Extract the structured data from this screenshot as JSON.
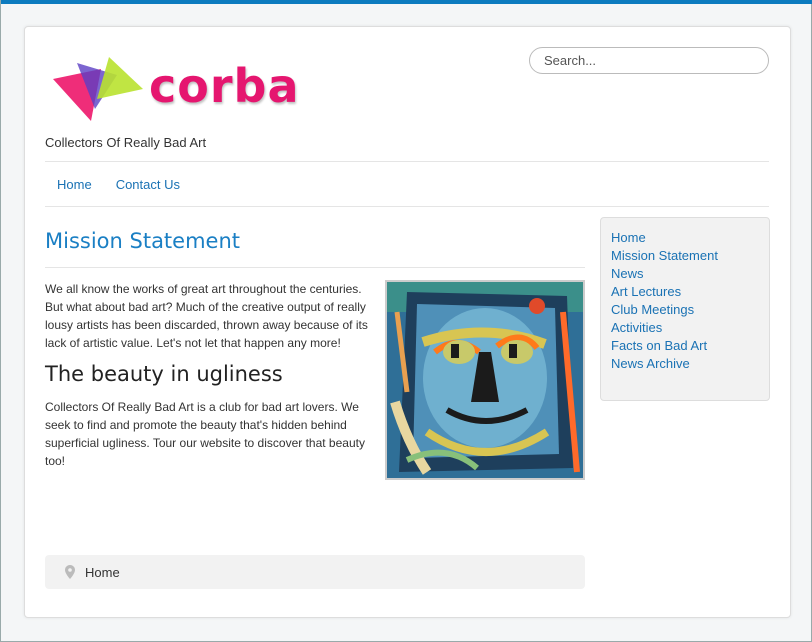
{
  "site": {
    "logo_text": "corba",
    "tagline": "Collectors Of Really Bad Art"
  },
  "search": {
    "placeholder": "Search..."
  },
  "nav": {
    "items": [
      {
        "label": "Home"
      },
      {
        "label": "Contact Us"
      }
    ]
  },
  "article": {
    "title": "Mission Statement",
    "intro": "We all know the works of great art throughout the centuries. But what about bad art? Much of the creative output of really lousy artists has been discarded, thrown away because of its lack of artistic value. Let's not let that happen any more!",
    "subheading": "The beauty in ugliness",
    "body": "Collectors Of Really Bad Art is a club for bad art lovers. We seek to find and promote the beauty that's hidden behind superficial ugliness. Tour our website to discover that beauty too!"
  },
  "sidebar": {
    "items": [
      {
        "label": "Home"
      },
      {
        "label": "Mission Statement"
      },
      {
        "label": "News"
      },
      {
        "label": "Art Lectures"
      },
      {
        "label": "Club Meetings"
      },
      {
        "label": "Activities"
      },
      {
        "label": "Facts on Bad Art"
      },
      {
        "label": "News Archive"
      }
    ]
  },
  "breadcrumb": {
    "current": "Home",
    "icon": "map-pin-icon"
  },
  "colors": {
    "accent": "#1a7fc4",
    "brand": "#e5166f",
    "topbar": "#0c7bbf"
  }
}
